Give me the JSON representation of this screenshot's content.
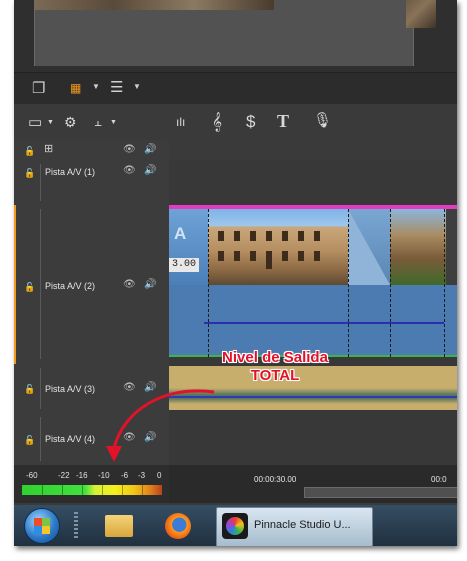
{
  "tracks": [
    {
      "label": "Pista A/V (1)"
    },
    {
      "label": "Pista A/V (2)"
    },
    {
      "label": "Pista A/V (3)"
    },
    {
      "label": "Pista A/V (4)"
    }
  ],
  "timeline": {
    "timecode": "3.00",
    "transition_letter": "A",
    "ruler_labels": [
      "00:00:30.00",
      "00:0"
    ]
  },
  "meter": {
    "scale": [
      "-60",
      "-22",
      "-16",
      "-10",
      "-6",
      "-3",
      "0"
    ]
  },
  "annotation": {
    "line1": "Nivel de Salida",
    "line2": "TOTAL",
    "color": "#e2122a"
  },
  "taskbar": {
    "active_window_label": "Pinnacle Studio U..."
  },
  "icons": {
    "view_bar": [
      "duplicate-icon",
      "grid-view-icon",
      "list-view-icon"
    ],
    "toolbar": [
      "storyboard-icon",
      "settings-gear-icon",
      "align-icon",
      "audio-levels-icon",
      "music-clef-icon",
      "sound-effect-icon",
      "title-text-icon",
      "microphone-icon"
    ]
  }
}
